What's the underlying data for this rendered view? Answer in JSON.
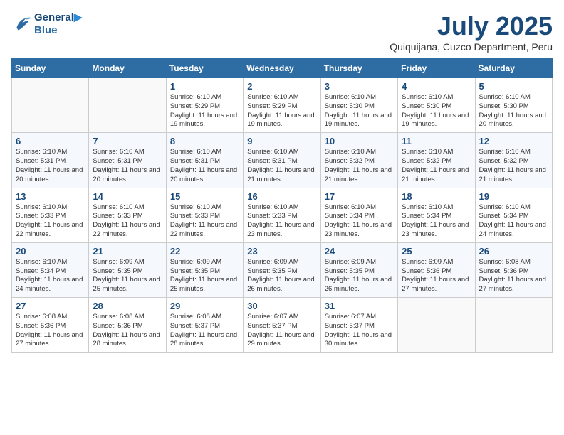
{
  "header": {
    "logo_line1": "General",
    "logo_line2": "Blue",
    "month_title": "July 2025",
    "subtitle": "Quiquijana, Cuzco Department, Peru"
  },
  "weekdays": [
    "Sunday",
    "Monday",
    "Tuesday",
    "Wednesday",
    "Thursday",
    "Friday",
    "Saturday"
  ],
  "weeks": [
    [
      {
        "day": "",
        "sunrise": "",
        "sunset": "",
        "daylight": ""
      },
      {
        "day": "",
        "sunrise": "",
        "sunset": "",
        "daylight": ""
      },
      {
        "day": "1",
        "sunrise": "Sunrise: 6:10 AM",
        "sunset": "Sunset: 5:29 PM",
        "daylight": "Daylight: 11 hours and 19 minutes."
      },
      {
        "day": "2",
        "sunrise": "Sunrise: 6:10 AM",
        "sunset": "Sunset: 5:29 PM",
        "daylight": "Daylight: 11 hours and 19 minutes."
      },
      {
        "day": "3",
        "sunrise": "Sunrise: 6:10 AM",
        "sunset": "Sunset: 5:30 PM",
        "daylight": "Daylight: 11 hours and 19 minutes."
      },
      {
        "day": "4",
        "sunrise": "Sunrise: 6:10 AM",
        "sunset": "Sunset: 5:30 PM",
        "daylight": "Daylight: 11 hours and 19 minutes."
      },
      {
        "day": "5",
        "sunrise": "Sunrise: 6:10 AM",
        "sunset": "Sunset: 5:30 PM",
        "daylight": "Daylight: 11 hours and 20 minutes."
      }
    ],
    [
      {
        "day": "6",
        "sunrise": "Sunrise: 6:10 AM",
        "sunset": "Sunset: 5:31 PM",
        "daylight": "Daylight: 11 hours and 20 minutes."
      },
      {
        "day": "7",
        "sunrise": "Sunrise: 6:10 AM",
        "sunset": "Sunset: 5:31 PM",
        "daylight": "Daylight: 11 hours and 20 minutes."
      },
      {
        "day": "8",
        "sunrise": "Sunrise: 6:10 AM",
        "sunset": "Sunset: 5:31 PM",
        "daylight": "Daylight: 11 hours and 20 minutes."
      },
      {
        "day": "9",
        "sunrise": "Sunrise: 6:10 AM",
        "sunset": "Sunset: 5:31 PM",
        "daylight": "Daylight: 11 hours and 21 minutes."
      },
      {
        "day": "10",
        "sunrise": "Sunrise: 6:10 AM",
        "sunset": "Sunset: 5:32 PM",
        "daylight": "Daylight: 11 hours and 21 minutes."
      },
      {
        "day": "11",
        "sunrise": "Sunrise: 6:10 AM",
        "sunset": "Sunset: 5:32 PM",
        "daylight": "Daylight: 11 hours and 21 minutes."
      },
      {
        "day": "12",
        "sunrise": "Sunrise: 6:10 AM",
        "sunset": "Sunset: 5:32 PM",
        "daylight": "Daylight: 11 hours and 21 minutes."
      }
    ],
    [
      {
        "day": "13",
        "sunrise": "Sunrise: 6:10 AM",
        "sunset": "Sunset: 5:33 PM",
        "daylight": "Daylight: 11 hours and 22 minutes."
      },
      {
        "day": "14",
        "sunrise": "Sunrise: 6:10 AM",
        "sunset": "Sunset: 5:33 PM",
        "daylight": "Daylight: 11 hours and 22 minutes."
      },
      {
        "day": "15",
        "sunrise": "Sunrise: 6:10 AM",
        "sunset": "Sunset: 5:33 PM",
        "daylight": "Daylight: 11 hours and 22 minutes."
      },
      {
        "day": "16",
        "sunrise": "Sunrise: 6:10 AM",
        "sunset": "Sunset: 5:33 PM",
        "daylight": "Daylight: 11 hours and 23 minutes."
      },
      {
        "day": "17",
        "sunrise": "Sunrise: 6:10 AM",
        "sunset": "Sunset: 5:34 PM",
        "daylight": "Daylight: 11 hours and 23 minutes."
      },
      {
        "day": "18",
        "sunrise": "Sunrise: 6:10 AM",
        "sunset": "Sunset: 5:34 PM",
        "daylight": "Daylight: 11 hours and 23 minutes."
      },
      {
        "day": "19",
        "sunrise": "Sunrise: 6:10 AM",
        "sunset": "Sunset: 5:34 PM",
        "daylight": "Daylight: 11 hours and 24 minutes."
      }
    ],
    [
      {
        "day": "20",
        "sunrise": "Sunrise: 6:10 AM",
        "sunset": "Sunset: 5:34 PM",
        "daylight": "Daylight: 11 hours and 24 minutes."
      },
      {
        "day": "21",
        "sunrise": "Sunrise: 6:09 AM",
        "sunset": "Sunset: 5:35 PM",
        "daylight": "Daylight: 11 hours and 25 minutes."
      },
      {
        "day": "22",
        "sunrise": "Sunrise: 6:09 AM",
        "sunset": "Sunset: 5:35 PM",
        "daylight": "Daylight: 11 hours and 25 minutes."
      },
      {
        "day": "23",
        "sunrise": "Sunrise: 6:09 AM",
        "sunset": "Sunset: 5:35 PM",
        "daylight": "Daylight: 11 hours and 26 minutes."
      },
      {
        "day": "24",
        "sunrise": "Sunrise: 6:09 AM",
        "sunset": "Sunset: 5:35 PM",
        "daylight": "Daylight: 11 hours and 26 minutes."
      },
      {
        "day": "25",
        "sunrise": "Sunrise: 6:09 AM",
        "sunset": "Sunset: 5:36 PM",
        "daylight": "Daylight: 11 hours and 27 minutes."
      },
      {
        "day": "26",
        "sunrise": "Sunrise: 6:08 AM",
        "sunset": "Sunset: 5:36 PM",
        "daylight": "Daylight: 11 hours and 27 minutes."
      }
    ],
    [
      {
        "day": "27",
        "sunrise": "Sunrise: 6:08 AM",
        "sunset": "Sunset: 5:36 PM",
        "daylight": "Daylight: 11 hours and 27 minutes."
      },
      {
        "day": "28",
        "sunrise": "Sunrise: 6:08 AM",
        "sunset": "Sunset: 5:36 PM",
        "daylight": "Daylight: 11 hours and 28 minutes."
      },
      {
        "day": "29",
        "sunrise": "Sunrise: 6:08 AM",
        "sunset": "Sunset: 5:37 PM",
        "daylight": "Daylight: 11 hours and 28 minutes."
      },
      {
        "day": "30",
        "sunrise": "Sunrise: 6:07 AM",
        "sunset": "Sunset: 5:37 PM",
        "daylight": "Daylight: 11 hours and 29 minutes."
      },
      {
        "day": "31",
        "sunrise": "Sunrise: 6:07 AM",
        "sunset": "Sunset: 5:37 PM",
        "daylight": "Daylight: 11 hours and 30 minutes."
      },
      {
        "day": "",
        "sunrise": "",
        "sunset": "",
        "daylight": ""
      },
      {
        "day": "",
        "sunrise": "",
        "sunset": "",
        "daylight": ""
      }
    ]
  ]
}
